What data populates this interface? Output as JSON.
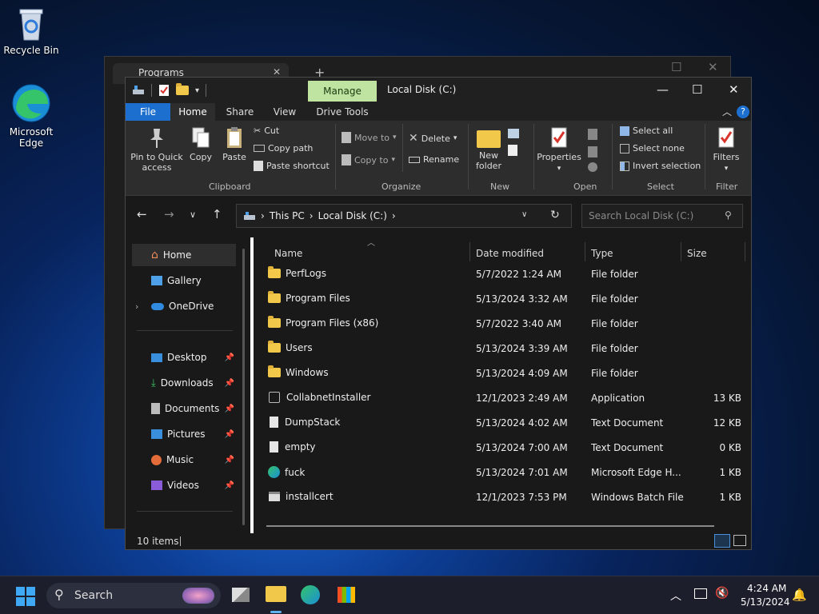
{
  "desktop": {
    "recycle_bin": "Recycle Bin",
    "edge_line1": "Microsoft",
    "edge_line2": "Edge"
  },
  "background_window": {
    "tab_title": "Programs"
  },
  "window": {
    "title": "Local Disk (C:)",
    "manage_tab": "Manage",
    "ribbon_tabs": [
      "File",
      "Home",
      "Share",
      "View",
      "Drive Tools"
    ]
  },
  "ribbon": {
    "clipboard": {
      "pin_line1": "Pin to Quick",
      "pin_line2": "access",
      "copy": "Copy",
      "paste": "Paste",
      "cut": "Cut",
      "copy_path": "Copy path",
      "paste_shortcut": "Paste shortcut",
      "label": "Clipboard"
    },
    "organize": {
      "move_to": "Move to",
      "copy_to": "Copy to",
      "delete": "Delete",
      "rename": "Rename",
      "label": "Organize"
    },
    "new": {
      "new_folder_line1": "New",
      "new_folder_line2": "folder",
      "label": "New"
    },
    "open": {
      "properties": "Properties",
      "label": "Open"
    },
    "select": {
      "select_all": "Select all",
      "select_none": "Select none",
      "invert_selection": "Invert selection",
      "label": "Select"
    },
    "filter": {
      "filters": "Filters",
      "label": "Filter"
    }
  },
  "address": {
    "crumbs": [
      "This PC",
      "Local Disk (C:)"
    ],
    "search_placeholder": "Search Local Disk (C:)"
  },
  "navpane": {
    "items": [
      {
        "label": "Home",
        "icon": "home-icon",
        "selected": true
      },
      {
        "label": "Gallery",
        "icon": "gallery-icon"
      },
      {
        "label": "OneDrive",
        "icon": "cloud-icon"
      }
    ],
    "pinned": [
      {
        "label": "Desktop",
        "icon": "desktop-icon"
      },
      {
        "label": "Downloads",
        "icon": "download-icon"
      },
      {
        "label": "Documents",
        "icon": "document-icon"
      },
      {
        "label": "Pictures",
        "icon": "picture-icon"
      },
      {
        "label": "Music",
        "icon": "music-icon"
      },
      {
        "label": "Videos",
        "icon": "video-icon"
      }
    ]
  },
  "columns": [
    "Name",
    "Date modified",
    "Type",
    "Size"
  ],
  "files": [
    {
      "name": "PerfLogs",
      "date": "5/7/2022 1:24 AM",
      "type": "File folder",
      "size": "",
      "icon": "folder"
    },
    {
      "name": "Program Files",
      "date": "5/13/2024 3:32 AM",
      "type": "File folder",
      "size": "",
      "icon": "folder"
    },
    {
      "name": "Program Files (x86)",
      "date": "5/7/2022 3:40 AM",
      "type": "File folder",
      "size": "",
      "icon": "folder"
    },
    {
      "name": "Users",
      "date": "5/13/2024 3:39 AM",
      "type": "File folder",
      "size": "",
      "icon": "folder"
    },
    {
      "name": "Windows",
      "date": "5/13/2024 4:09 AM",
      "type": "File folder",
      "size": "",
      "icon": "folder"
    },
    {
      "name": "CollabnetInstaller",
      "date": "12/1/2023 2:49 AM",
      "type": "Application",
      "size": "13 KB",
      "icon": "app"
    },
    {
      "name": "DumpStack",
      "date": "5/13/2024 4:02 AM",
      "type": "Text Document",
      "size": "12 KB",
      "icon": "doc"
    },
    {
      "name": "empty",
      "date": "5/13/2024 7:00 AM",
      "type": "Text Document",
      "size": "0 KB",
      "icon": "doc"
    },
    {
      "name": "fuck",
      "date": "5/13/2024 7:01 AM",
      "type": "Microsoft Edge H...",
      "size": "1 KB",
      "icon": "edge"
    },
    {
      "name": "installcert",
      "date": "12/1/2023 7:53 PM",
      "type": "Windows Batch File",
      "size": "1 KB",
      "icon": "batch"
    }
  ],
  "status": {
    "items": "10 items"
  },
  "taskbar": {
    "search": "Search",
    "time": "4:24 AM",
    "date": "5/13/2024"
  },
  "colors": {
    "accent": "#1c6fce",
    "manage_tab": "#bfe3a0",
    "folder": "#f2c84b"
  }
}
